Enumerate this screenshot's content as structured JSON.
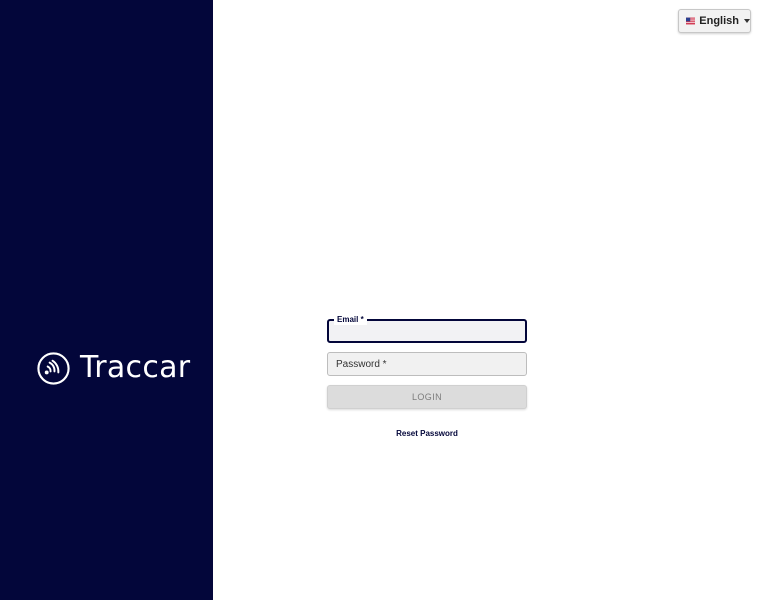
{
  "brand": {
    "name": "Traccar",
    "logo_icon": "traccar-signal-logo-icon",
    "sidebar_color": "#03063a"
  },
  "language": {
    "label": "English",
    "flag_icon": "us-flag-icon",
    "caret_icon": "chevron-down-icon"
  },
  "login_form": {
    "email_label": "Email *",
    "email_value": "",
    "password_label": "Password *",
    "password_value": "",
    "login_button": "LOGIN",
    "login_enabled": false,
    "reset_link": "Reset Password",
    "accent_color": "#03063a"
  }
}
